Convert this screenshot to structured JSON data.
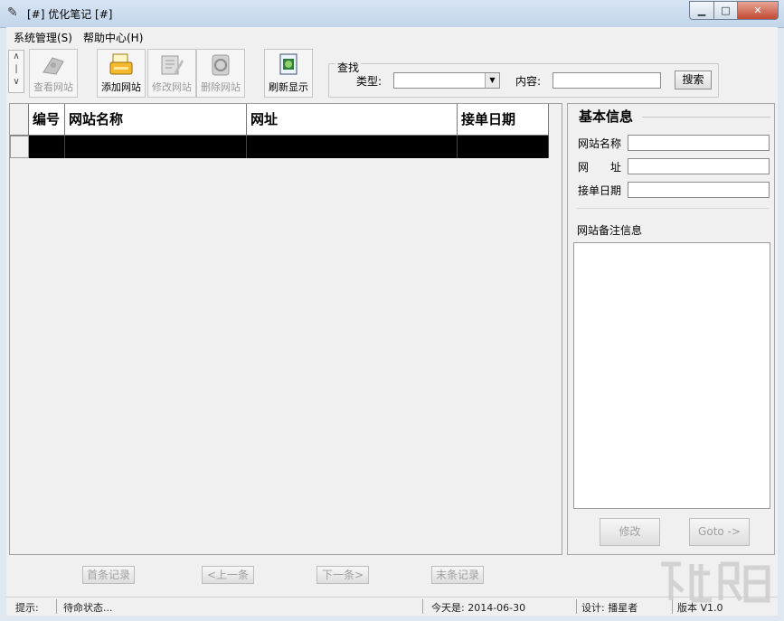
{
  "window": {
    "title": "[#] 优化笔记 [#]",
    "min_glyph": "▁",
    "max_glyph": "□",
    "close_glyph": "✕"
  },
  "menu": [
    "系统管理(S)",
    "帮助中心(H)"
  ],
  "toolbar": {
    "scroll_up": "∧",
    "scroll_down": "∨",
    "buttons": [
      {
        "label": "查看网站",
        "icon": "view-site-icon",
        "enabled": false
      },
      {
        "label": "添加网站",
        "icon": "add-site-icon",
        "enabled": true
      },
      {
        "label": "修改网站",
        "icon": "edit-site-icon",
        "enabled": false
      },
      {
        "label": "删除网站",
        "icon": "delete-site-icon",
        "enabled": false
      },
      {
        "label": "刷新显示",
        "icon": "refresh-icon",
        "enabled": true
      }
    ]
  },
  "search": {
    "group_label": "查找",
    "type_label": "类型:",
    "type_value": "",
    "content_label": "内容:",
    "content_value": "",
    "button": "搜索"
  },
  "table": {
    "columns": [
      "编号",
      "网站名称",
      "网址",
      "接单日期"
    ],
    "rows": [
      [
        "",
        "",
        "",
        ""
      ]
    ]
  },
  "detail": {
    "title": "基本信息",
    "fields": [
      {
        "label": "网站名称",
        "value": ""
      },
      {
        "label": "网　　址",
        "value": ""
      },
      {
        "label": "接单日期",
        "value": ""
      }
    ],
    "memo_label": "网站备注信息",
    "memo_value": "",
    "edit_button": "修改",
    "goto_button": "Goto ->"
  },
  "pager": [
    "首条记录",
    "<上一条",
    "下一条>",
    "末条记录"
  ],
  "status": {
    "hint_label": "提示:",
    "hint_value": "待命状态...",
    "today": "今天是: 2014-06-30",
    "designer": "设计: 播星者",
    "version": "版本 V1.0"
  },
  "colors": {
    "titlebar": "#c9d9ec",
    "face": "#f0f0f0",
    "selection": "#000000",
    "close": "#c9452f"
  }
}
